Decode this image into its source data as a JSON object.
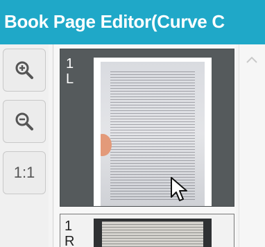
{
  "window": {
    "title": "Book Page Editor(Curve C"
  },
  "toolbar": {
    "zoom_in_icon": "zoom-in-icon",
    "zoom_out_icon": "zoom-out-icon",
    "actual_size_label": "1:1"
  },
  "thumbnails": [
    {
      "label": "1\nL",
      "selected": true
    },
    {
      "label": "1\nR",
      "selected": false
    }
  ],
  "colors": {
    "title_bar": "#1fa8c8",
    "selected_thumb_bg": "#555a5c"
  }
}
